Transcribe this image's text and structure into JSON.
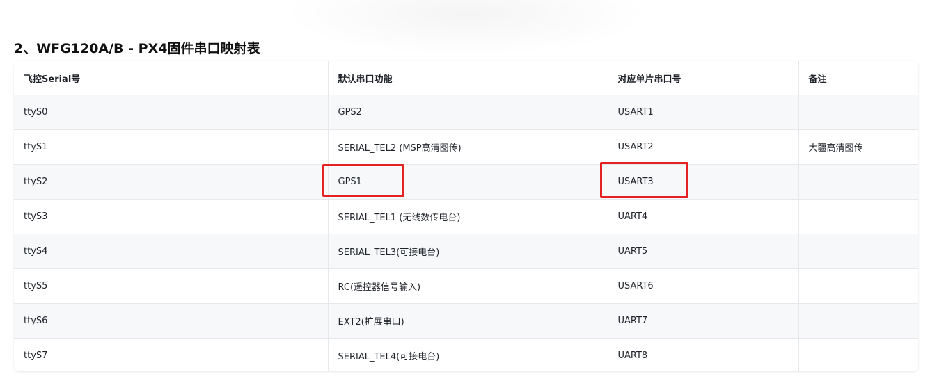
{
  "page": {
    "title": "2、WFG120A/B - PX4固件串口映射表"
  },
  "table": {
    "headers": [
      "飞控Serial号",
      "默认串口功能",
      "对应单片串口号",
      "备注"
    ],
    "rows": [
      [
        "ttyS0",
        "GPS2",
        "USART1",
        ""
      ],
      [
        "ttyS1",
        "SERIAL_TEL2 (MSP高清图传)",
        "USART2",
        "大疆高清图传"
      ],
      [
        "ttyS2",
        "GPS1",
        "USART3",
        ""
      ],
      [
        "ttyS3",
        "SERIAL_TEL1 (无线数传电台)",
        "UART4",
        ""
      ],
      [
        "ttyS4",
        "SERIAL_TEL3(可接电台)",
        "UART5",
        ""
      ],
      [
        "ttyS5",
        "RC(遥控器信号输入)",
        "USART6",
        ""
      ],
      [
        "ttyS6",
        "EXT2(扩展串口)",
        "UART7",
        ""
      ],
      [
        "ttyS7",
        "SERIAL_TEL4(可接电台)",
        "UART8",
        ""
      ]
    ]
  },
  "highlights": {
    "color": "#e32221",
    "cells": [
      "GPS1",
      "USART3"
    ]
  }
}
